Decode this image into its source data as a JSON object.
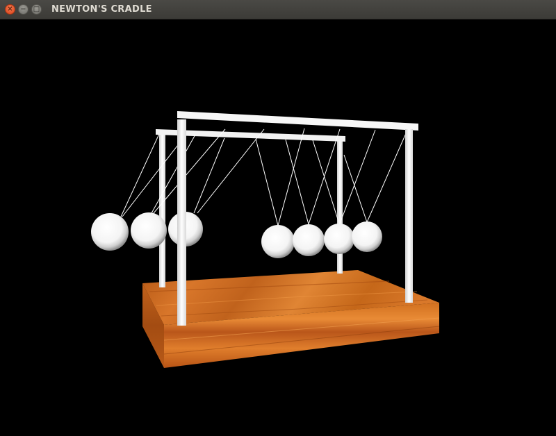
{
  "window": {
    "title": "NEWTON'S CRADLE",
    "controls": {
      "close_icon": "close-icon",
      "minimize_icon": "minimize-icon",
      "maximize_icon": "maximize-icon"
    }
  },
  "scene": {
    "background": "#000000",
    "ball_color": "#ffffff",
    "frame_color": "#ffffff",
    "base_color": "#c8651a",
    "ball_count": 7
  }
}
